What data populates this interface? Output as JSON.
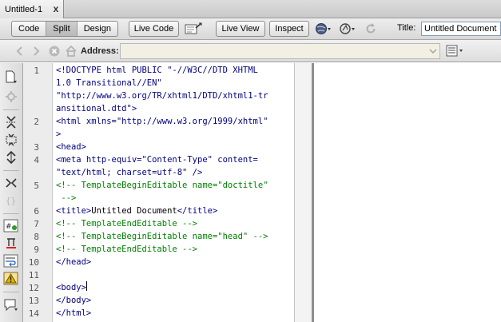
{
  "document_tab": {
    "title": "Untitled-1",
    "close_glyph": "x"
  },
  "toolbar": {
    "view_modes": [
      {
        "label": "Code"
      },
      {
        "label": "Split",
        "active": true
      },
      {
        "label": "Design"
      }
    ],
    "live_code_label": "Live Code",
    "live_view_label": "Live View",
    "inspect_label": "Inspect",
    "title_label": "Title:",
    "title_value": "Untitled Document"
  },
  "address_bar": {
    "label": "Address:",
    "value": ""
  },
  "editor": {
    "line_numbers": [
      "1",
      "2",
      "3",
      "4",
      "5",
      "6",
      "7",
      "8",
      "9",
      "10",
      "11",
      "12",
      "13",
      "14"
    ],
    "lines": [
      {
        "text": "<!DOCTYPE html PUBLIC \"-//W3C//DTD XHTML",
        "style": "tag"
      },
      {
        "text": "1.0 Transitional//EN\"",
        "style": "tag"
      },
      {
        "text": "\"http://www.w3.org/TR/xhtml1/DTD/xhtml1-tr",
        "style": "tag"
      },
      {
        "text": "ansitional.dtd\">",
        "style": "tag"
      },
      {
        "text": "<html xmlns=\"http://www.w3.org/1999/xhtml\"",
        "style": "tag"
      },
      {
        "text": ">",
        "style": "tag"
      },
      {
        "text": "<head>",
        "style": "tag"
      },
      {
        "text": "<meta http-equiv=\"Content-Type\" content=",
        "style": "tag"
      },
      {
        "text": "\"text/html; charset=utf-8\" />",
        "style": "tag"
      },
      {
        "text": "<!-- TemplateBeginEditable name=\"doctitle\"",
        "style": "comment"
      },
      {
        "text": " -->",
        "style": "comment"
      },
      {
        "text": "<title>",
        "style": "tag"
      },
      {
        "text": "Untitled Document",
        "style": "text"
      },
      {
        "text": "</title>",
        "style": "tag"
      },
      {
        "text": "<!-- TemplateEndEditable -->",
        "style": "comment"
      },
      {
        "text": "<!-- TemplateBeginEditable name=\"head\" -->",
        "style": "comment"
      },
      {
        "text": "<!-- TemplateEndEditable -->",
        "style": "comment"
      },
      {
        "text": "</head>",
        "style": "tag"
      },
      {
        "text": "<body>",
        "style": "tag"
      },
      {
        "text": "</body>",
        "style": "tag"
      },
      {
        "text": "</html>",
        "style": "tag"
      }
    ]
  },
  "icons": {
    "multiscreen": "multiscreen-icon",
    "validate": "validate-markup-icon",
    "browser_preview": "globe-icon",
    "file_management": "file-management-icon",
    "refresh": "refresh-icon",
    "back": "back-arrow-icon",
    "forward": "forward-arrow-icon",
    "stop": "stop-icon",
    "home": "home-icon"
  },
  "colors": {
    "code_tag": "#000080",
    "code_comment": "#008000",
    "code_text": "#000000",
    "gutter_bg": "#ececec",
    "address_field_bg": "#f1f0e3"
  }
}
